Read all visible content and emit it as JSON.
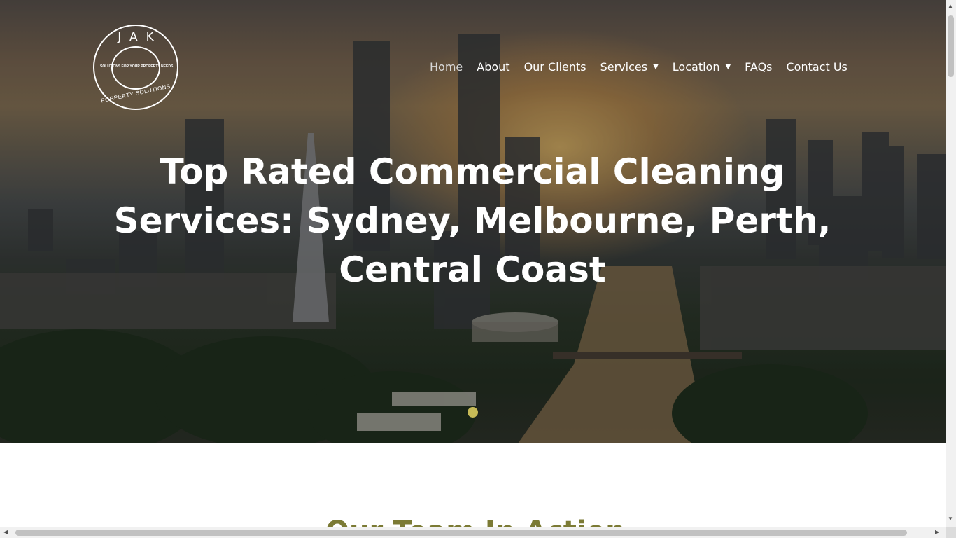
{
  "logo": {
    "letters": "JAK",
    "tagline": "SOLUTIONS FOR YOUR PROPERTY NEEDS",
    "bottom_text": "PORPERTY SOLUTIONS"
  },
  "nav": {
    "items": [
      {
        "label": "Home",
        "active": true,
        "dropdown": false
      },
      {
        "label": "About",
        "active": false,
        "dropdown": false
      },
      {
        "label": "Our Clients",
        "active": false,
        "dropdown": false
      },
      {
        "label": "Services",
        "active": false,
        "dropdown": true
      },
      {
        "label": "Location",
        "active": false,
        "dropdown": true
      },
      {
        "label": "FAQs",
        "active": false,
        "dropdown": false
      },
      {
        "label": "Contact Us",
        "active": false,
        "dropdown": false
      }
    ],
    "caret": "▼"
  },
  "hero": {
    "headline": "Top Rated Commercial Cleaning Services: Sydney, Melbourne, Perth, Central Coast"
  },
  "section": {
    "title": "Our Team In Action"
  },
  "colors": {
    "accent": "#c7bb57",
    "section_title": "#7b7a34"
  },
  "scrollbars": {
    "up": "▲",
    "down": "▼",
    "left": "◀",
    "right": "▶"
  }
}
